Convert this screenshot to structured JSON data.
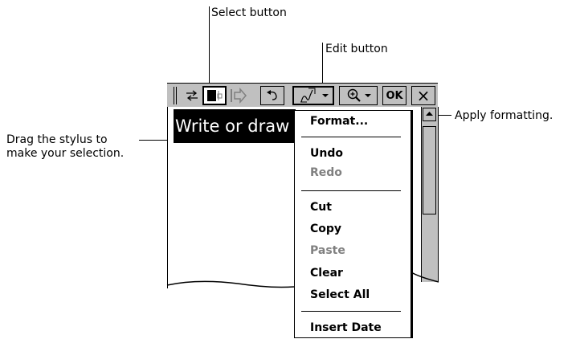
{
  "callouts": {
    "select_button": "Select button",
    "edit_button": "Edit button",
    "apply_formatting": "Apply formatting.",
    "drag_stylus_line1": "Drag the stylus to",
    "drag_stylus_line2": "make your selection."
  },
  "toolbar": {
    "ok_label": "OK",
    "close_label": "×"
  },
  "document": {
    "selected_text": "Write or draw"
  },
  "menu": {
    "items": [
      {
        "label": "Format...",
        "enabled": true
      },
      {
        "label": "Undo",
        "enabled": true
      },
      {
        "label": "Redo",
        "enabled": false
      },
      {
        "label": "Cut",
        "enabled": true
      },
      {
        "label": "Copy",
        "enabled": true
      },
      {
        "label": "Paste",
        "enabled": false
      },
      {
        "label": "Clear",
        "enabled": true
      },
      {
        "label": "Select All",
        "enabled": true
      },
      {
        "label": "Insert Date",
        "enabled": true
      }
    ]
  },
  "colors": {
    "toolbar_bg": "#c0c0c0",
    "disabled_text": "#808080",
    "selection_bg": "#000000"
  }
}
